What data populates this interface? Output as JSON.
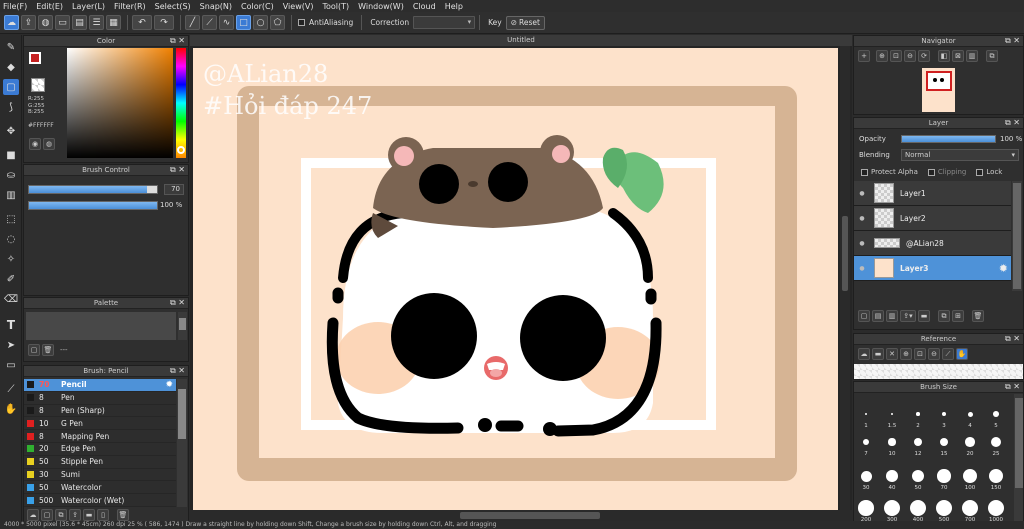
{
  "menu": [
    "File(F)",
    "Edit(E)",
    "Layer(L)",
    "Filter(R)",
    "Select(S)",
    "Snap(N)",
    "Color(C)",
    "View(V)",
    "Tool(T)",
    "Window(W)",
    "Cloud",
    "Help"
  ],
  "toolbar": {
    "antialiasing_label": "AntiAliasing",
    "correction_label": "Correction",
    "key_label": "Key",
    "reset_label": "Reset"
  },
  "canvas": {
    "title": "Untitled",
    "watermark_line1": "@ALian28",
    "watermark_line2": "#Hỏi đáp 247",
    "bg_color": "#fde2cb"
  },
  "color_panel": {
    "title": "Color",
    "r": "R:255",
    "g": "G:255",
    "b": "B:255",
    "hex": "#FFFFFF"
  },
  "brush_control": {
    "title": "Brush Control",
    "size": "70",
    "opacity": "100 %",
    "size_ratio": 0.92,
    "opacity_ratio": 1.0
  },
  "palette": {
    "title": "Palette",
    "dash": "---"
  },
  "brush_list": {
    "title": "Brush: Pencil",
    "items": [
      {
        "size": "70",
        "name": "Pencil",
        "color": "#1a1a1a",
        "selected": true
      },
      {
        "size": "8",
        "name": "Pen",
        "color": "#1a1a1a"
      },
      {
        "size": "8",
        "name": "Pen (Sharp)",
        "color": "#1a1a1a"
      },
      {
        "size": "10",
        "name": "G Pen",
        "color": "#e02020"
      },
      {
        "size": "8",
        "name": "Mapping Pen",
        "color": "#e02020"
      },
      {
        "size": "20",
        "name": "Edge Pen",
        "color": "#30b030"
      },
      {
        "size": "50",
        "name": "Stipple Pen",
        "color": "#e8d020"
      },
      {
        "size": "30",
        "name": "Sumi",
        "color": "#e8d020"
      },
      {
        "size": "50",
        "name": "Watercolor",
        "color": "#39a0e8"
      },
      {
        "size": "500",
        "name": "Watercolor (Wet)",
        "color": "#39a0e8"
      }
    ]
  },
  "navigator": {
    "title": "Navigator"
  },
  "layer_panel": {
    "title": "Layer",
    "opacity_label": "Opacity",
    "opacity_value": "100 %",
    "opacity_ratio": 1.0,
    "blending_label": "Blending",
    "blending_value": "Normal",
    "protect_alpha": "Protect Alpha",
    "clipping": "Clipping",
    "lock": "Lock",
    "layers": [
      {
        "name": "Layer1"
      },
      {
        "name": "Layer2"
      },
      {
        "name": "@ALian28"
      },
      {
        "name": "Layer3",
        "selected": true
      }
    ]
  },
  "reference": {
    "title": "Reference"
  },
  "brush_size": {
    "title": "Brush Size",
    "labels": [
      "1",
      "1.5",
      "2",
      "3",
      "4",
      "5",
      "7",
      "10",
      "12",
      "15",
      "20",
      "25",
      "30",
      "40",
      "50",
      "70",
      "100",
      "150",
      "200",
      "300",
      "400",
      "500",
      "700",
      "1000"
    ]
  },
  "status": {
    "text": "4000 * 5000 pixel   (35.6 * 45cm)   260 dpi   25 %   ( 586, 1474 )   Draw a straight line by holding down Shift, Change a brush size by holding down Ctrl, Alt, and dragging"
  }
}
